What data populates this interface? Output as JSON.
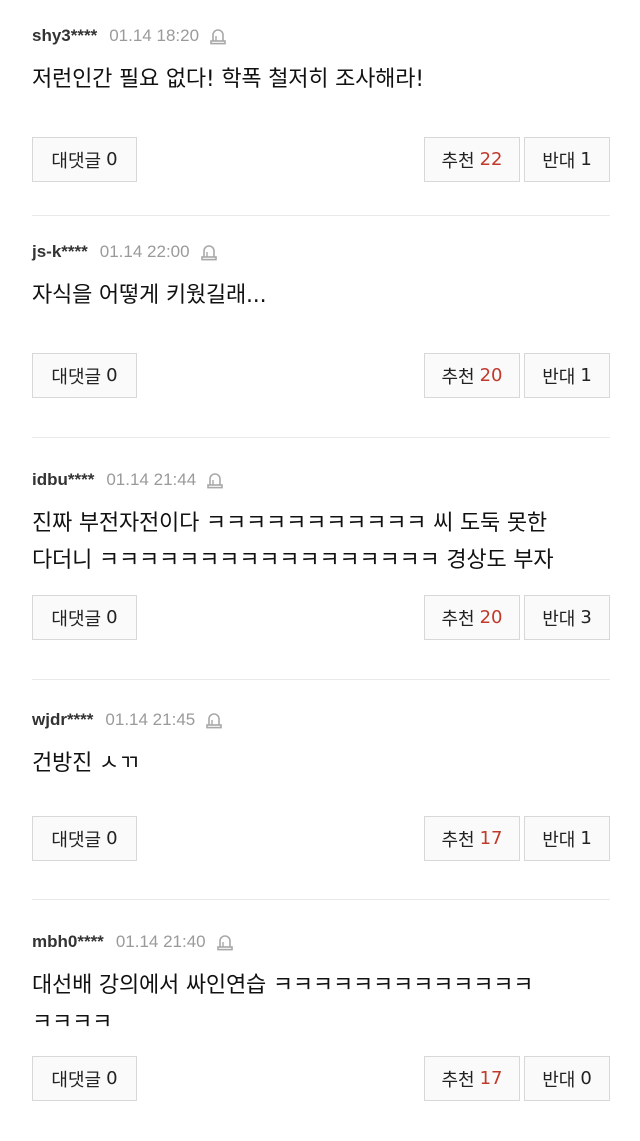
{
  "labels": {
    "reply": "대댓글",
    "upvote": "추천",
    "downvote": "반대"
  },
  "colors": {
    "upvote_count": "#c0392b",
    "username": "#333333",
    "datetime": "#9a9a9a"
  },
  "icons": {
    "report": "report-siren-icon"
  },
  "comments": [
    {
      "username": "shy3****",
      "datetime": "01.14 18:20",
      "text_lines": [
        "저런인간 필요 없다! 학폭 철저히 조사해라!"
      ],
      "reply_count": "0",
      "upvotes": "22",
      "downvotes": "1"
    },
    {
      "username": "js-k****",
      "datetime": "01.14 22:00",
      "text_lines": [
        "자식을 어떻게 키웠길래..."
      ],
      "reply_count": "0",
      "upvotes": "20",
      "downvotes": "1"
    },
    {
      "username": "idbu****",
      "datetime": "01.14 21:44",
      "text_lines": [
        "진짜 부전자전이다 ㅋㅋㅋㅋㅋㅋㅋㅋㅋㅋㅋ 씨 도둑 못한",
        "다더니 ㅋㅋㅋㅋㅋㅋㅋㅋㅋㅋㅋㅋㅋㅋㅋㅋㅋ 경상도 부자"
      ],
      "reply_count": "0",
      "upvotes": "20",
      "downvotes": "3"
    },
    {
      "username": "wjdr****",
      "datetime": "01.14 21:45",
      "text_lines": [
        "건방진 ㅅㄲ"
      ],
      "reply_count": "0",
      "upvotes": "17",
      "downvotes": "1"
    },
    {
      "username": "mbh0****",
      "datetime": "01.14 21:40",
      "text_lines": [
        "대선배 강의에서 싸인연습 ㅋㅋㅋㅋㅋㅋㅋㅋㅋㅋㅋㅋㅋ",
        "ㅋㅋㅋㅋ"
      ],
      "reply_count": "0",
      "upvotes": "17",
      "downvotes": "0"
    }
  ]
}
